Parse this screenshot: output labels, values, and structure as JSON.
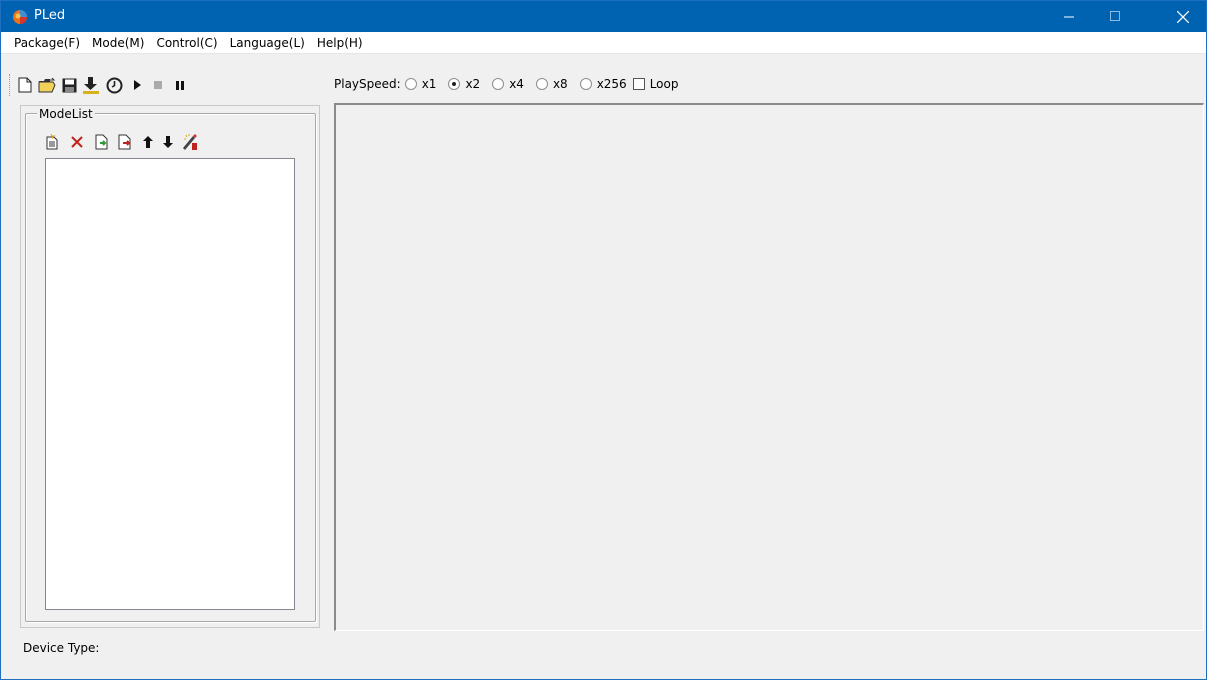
{
  "window": {
    "title": "PLed"
  },
  "menu": [
    "Package(F)",
    "Mode(M)",
    "Control(C)",
    "Language(L)",
    "Help(H)"
  ],
  "toolbar": {
    "icons": [
      "new-file-icon",
      "open-folder-icon",
      "save-icon",
      "download-icon",
      "timer-icon",
      "play-icon",
      "stop-icon",
      "pause-icon"
    ]
  },
  "playspeed": {
    "label": "PlaySpeed:",
    "options": [
      "x1",
      "x2",
      "x4",
      "x8",
      "x256"
    ],
    "selected": "x2",
    "loop_label": "Loop",
    "loop_checked": false
  },
  "modelist": {
    "label": "ModeList",
    "icons": [
      "add-mode-icon",
      "delete-icon",
      "import-icon",
      "export-icon",
      "move-up-icon",
      "move-down-icon",
      "edit-effect-icon"
    ],
    "items": []
  },
  "status": {
    "device_type_label": "Device Type:",
    "device_type_value": ""
  }
}
